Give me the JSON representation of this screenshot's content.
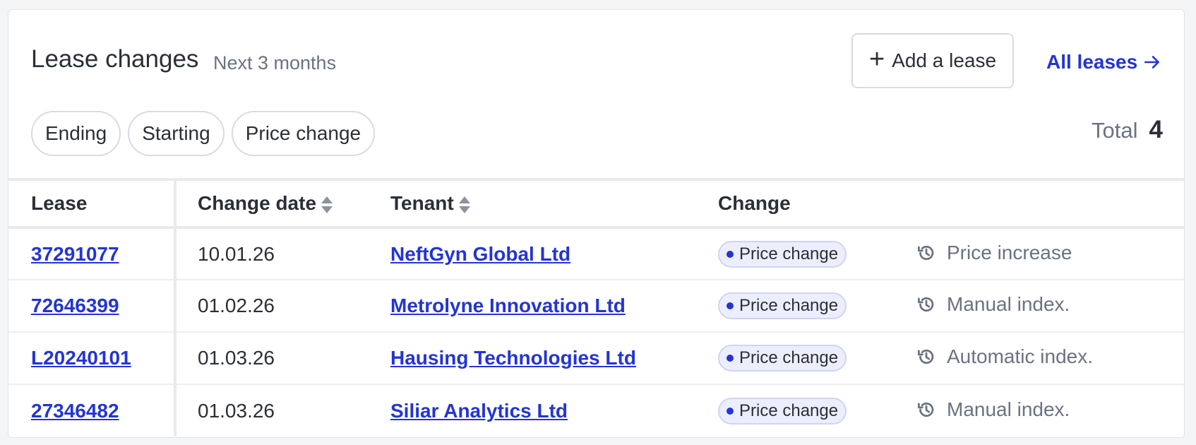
{
  "header": {
    "title": "Lease changes",
    "subtitle": "Next 3 months",
    "add_button": {
      "icon": "plus-icon",
      "label": "Add a lease"
    },
    "all_link": {
      "label": "All leases",
      "icon": "arrow-right-icon"
    }
  },
  "filters": [
    "Ending",
    "Starting",
    "Price change"
  ],
  "total": {
    "label": "Total",
    "value": "4"
  },
  "table": {
    "columns": {
      "lease": "Lease",
      "change_date": "Change date",
      "tenant": "Tenant",
      "change": "Change"
    },
    "rows": [
      {
        "lease": "37291077",
        "date": "10.01.26",
        "tenant": "NeftGyn Global Ltd",
        "change": "Price change",
        "note": "Price increase",
        "note_icon": "history-icon"
      },
      {
        "lease": "72646399",
        "date": "01.02.26",
        "tenant": "Metrolyne Innovation Ltd",
        "change": "Price change",
        "note": "Manual index.",
        "note_icon": "history-icon"
      },
      {
        "lease": "L20240101",
        "date": "01.03.26",
        "tenant": "Hausing Technologies Ltd",
        "change": "Price change",
        "note": "Automatic index.",
        "note_icon": "history-icon"
      },
      {
        "lease": "27346482",
        "date": "01.03.26",
        "tenant": "Siliar Analytics Ltd",
        "change": "Price change",
        "note": "Manual index.",
        "note_icon": "history-icon"
      }
    ]
  },
  "colors": {
    "link": "#2335d3",
    "badge_bg": "#eceefd",
    "muted": "#6b7280"
  }
}
